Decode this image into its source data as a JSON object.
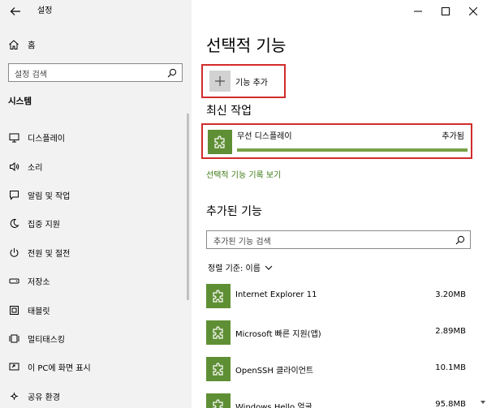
{
  "window": {
    "title": "설정",
    "back_icon": "arrow-left-icon",
    "controls": [
      "minimize-icon",
      "maximize-icon",
      "close-icon"
    ]
  },
  "sidebar": {
    "home_label": "홈",
    "search_placeholder": "설정 검색",
    "section_title": "시스템",
    "items": [
      {
        "label": "디스플레이",
        "icon": "monitor-icon"
      },
      {
        "label": "소리",
        "icon": "speaker-icon"
      },
      {
        "label": "알림 및 작업",
        "icon": "message-icon"
      },
      {
        "label": "집중 지원",
        "icon": "moon-icon"
      },
      {
        "label": "전원 및 절전",
        "icon": "power-icon"
      },
      {
        "label": "저장소",
        "icon": "drive-icon"
      },
      {
        "label": "태블릿",
        "icon": "tablet-icon"
      },
      {
        "label": "멀티태스킹",
        "icon": "multitask-icon"
      },
      {
        "label": "이 PC에 화면 표시",
        "icon": "project-icon"
      },
      {
        "label": "공유 환경",
        "icon": "share-icon"
      }
    ]
  },
  "main": {
    "page_title": "선택적 기능",
    "add_feature_label": "기능 추가",
    "recent_title": "최신 작업",
    "recent_item": {
      "name": "무선 디스플레이",
      "status": "추가됨",
      "progress": 1.0
    },
    "history_link": "선택적 기능 기록 보기",
    "installed_title": "추가된 기능",
    "search_placeholder": "추가된 기능 검색",
    "sort_label": "정렬 기준: 이름",
    "features": [
      {
        "name": "Internet Explorer 11",
        "size": "3.20MB"
      },
      {
        "name": "Microsoft 빠른 지원(앱)",
        "size": "2.89MB"
      },
      {
        "name": "OpenSSH 클라이언트",
        "size": "10.1MB"
      },
      {
        "name": "Windows Hello 얼굴",
        "size": "95.8MB"
      }
    ]
  },
  "colors": {
    "accent_green": "#5f8f34",
    "link_green": "#3c7a14",
    "highlight_red": "#d12c2c"
  }
}
